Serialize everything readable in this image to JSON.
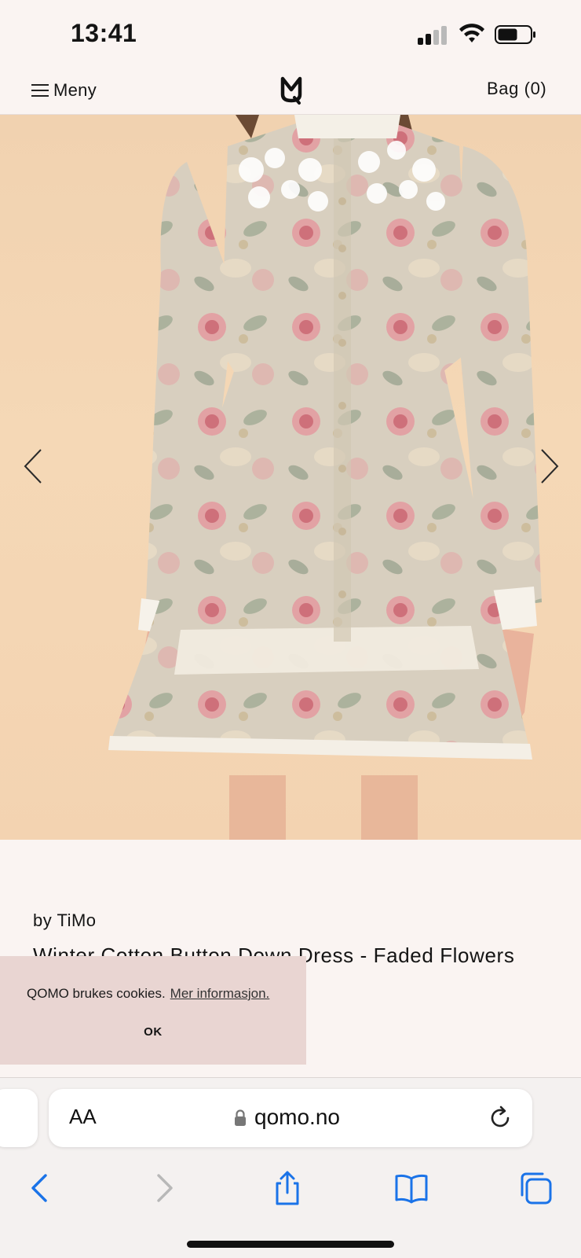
{
  "status_bar": {
    "time": "13:41"
  },
  "header": {
    "menu_label": "Meny",
    "bag_label": "Bag (0)"
  },
  "product": {
    "brand": "by TiMo",
    "name": "Winter Cotton Button Down Dress - Faded Flowers"
  },
  "cookie_banner": {
    "message": "QOMO brukes cookies.",
    "link_label": "Mer informasjon.",
    "ok_label": "OK"
  },
  "browser": {
    "text_size_label": "AA",
    "url": "qomo.no"
  },
  "colors": {
    "page_background": "#faf4f2",
    "cookie_background": "#e9d5d2",
    "ios_blue": "#1a73e8",
    "image_background": "#f3d3b1"
  },
  "icons": {
    "menu": "hamburger-icon",
    "logo": "qomo-logo",
    "carousel_prev": "chevron-left-icon",
    "carousel_next": "chevron-right-icon",
    "lock": "lock-icon",
    "reload": "reload-icon",
    "back": "back-arrow-icon",
    "forward": "forward-arrow-icon",
    "share": "share-icon",
    "bookmarks": "bookmarks-icon",
    "tabs": "tabs-icon"
  }
}
